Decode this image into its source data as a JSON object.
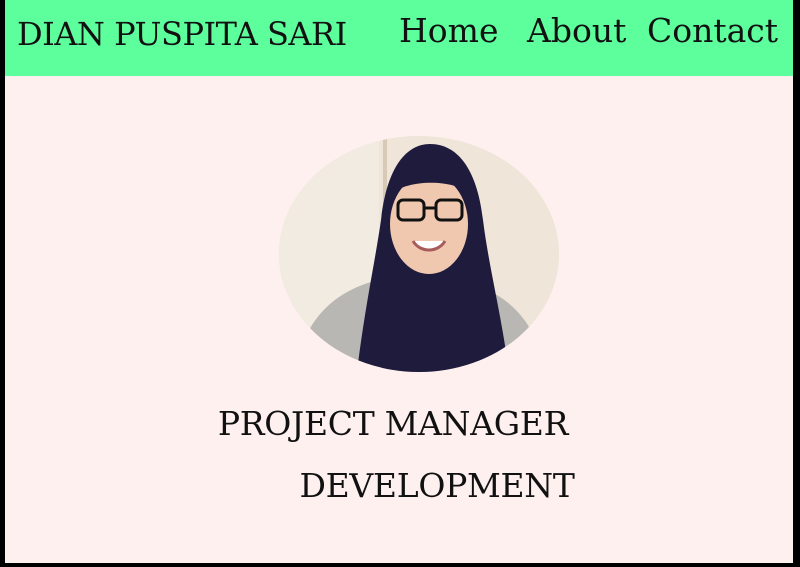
{
  "header": {
    "brand": "DIAN PUSPITA SARI",
    "nav": [
      {
        "label": "Home"
      },
      {
        "label": "About"
      },
      {
        "label": "Contact"
      }
    ]
  },
  "hero": {
    "role_line_1": "PROJECT MANAGER",
    "role_line_2": "DEVELOPMENT"
  },
  "colors": {
    "navbar": "#5dff9d",
    "page_background": "#fff0f0",
    "text": "#111111"
  }
}
